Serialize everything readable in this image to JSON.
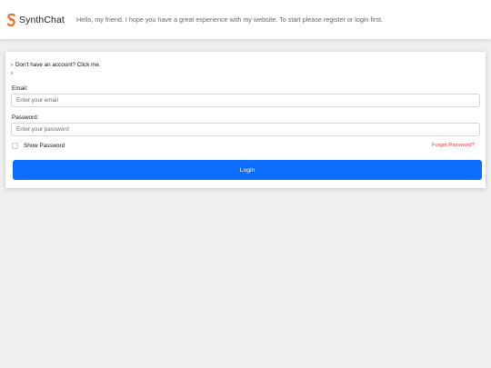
{
  "header": {
    "brand_name": "SynthChat",
    "welcome_text": "Hello, my friend. I hope you have a great experience with my website. To start please register or login first."
  },
  "login_form": {
    "register_link": "Don't have an account? Click me.",
    "second_link": "",
    "email_label": "Email:",
    "email_placeholder": "Enter your email",
    "password_label": "Password:",
    "password_placeholder": "Enter your password",
    "show_password_label": "Show Password",
    "forgot_password_label": "Forgot Password?",
    "login_button_label": "Login"
  },
  "colors": {
    "primary": "#0d6efd",
    "danger": "#e53935",
    "logo": "#e8732a",
    "background": "#efefef"
  },
  "icons": {
    "logo": "synthchat-logo-icon",
    "caret": "caret-right-icon"
  }
}
